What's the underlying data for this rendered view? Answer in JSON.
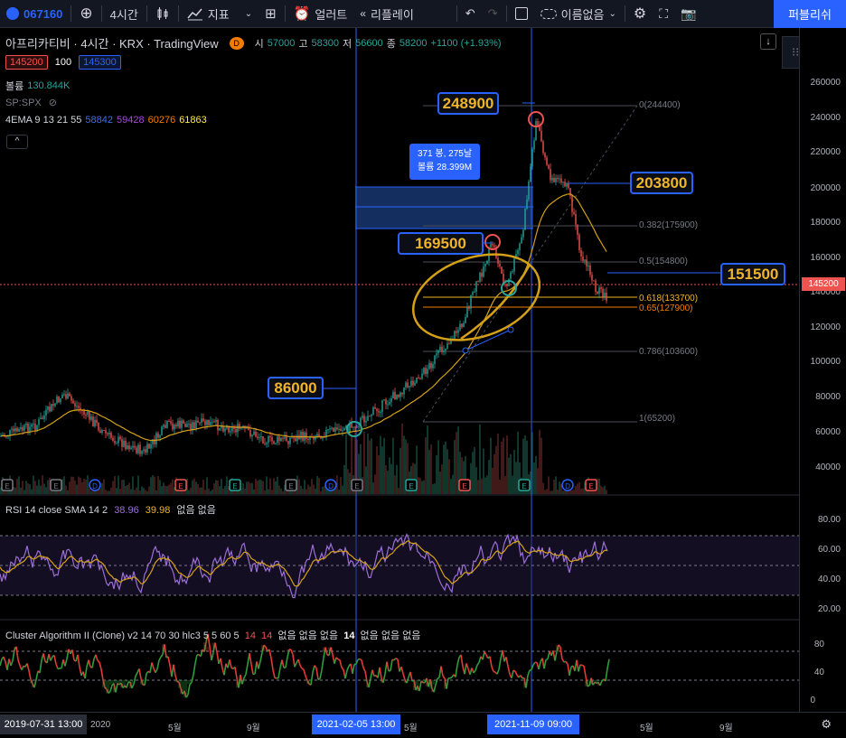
{
  "toolbar": {
    "symbol": "067160",
    "interval": "4시간",
    "indicators": "지표",
    "alert": "얼러트",
    "replay": "리플레이",
    "layout_name": "이름없음",
    "publish": "퍼블리쉬"
  },
  "header": {
    "title": "아프리카티비 · 4시간 · KRX · TradingView",
    "badge": "D",
    "o_label": "시",
    "o_val": "57000",
    "h_label": "고",
    "h_val": "58300",
    "l_label": "저",
    "l_val": "56600",
    "c_label": "종",
    "c_val": "58200",
    "change": "+1100 (+1.93%)",
    "bid": "145200",
    "spread": "100",
    "ask": "145300"
  },
  "legends": {
    "volume_label": "볼륨",
    "volume_val": "130.844K",
    "compare": "SP:SPX",
    "ema_label": "4EMA 9 13 21 55",
    "ema_vals": [
      "58842",
      "59428",
      "60276",
      "61863"
    ],
    "ema_colors": [
      "#3f6cf0",
      "#a04ad8",
      "#f57c00",
      "#ffeb3b"
    ]
  },
  "rsi": {
    "label": "RSI 14 close SMA 14 2",
    "val1": "38.96",
    "val2": "39.98",
    "extra": "없음 없음",
    "ticks": [
      "80.00",
      "60.00",
      "40.00",
      "20.00"
    ]
  },
  "cluster": {
    "label": "Cluster Algorithm II (Clone) v2 14 70 30 hlc3 5 5 60 5",
    "v1": "14",
    "v2": "14",
    "mid1": "없음 없음 없음",
    "v3": "14",
    "mid2": "없음 없음 없음",
    "ticks": [
      "80",
      "40",
      "0"
    ]
  },
  "price_ticks": [
    "260000",
    "240000",
    "220000",
    "200000",
    "180000",
    "160000",
    "140000",
    "120000",
    "100000",
    "80000",
    "60000",
    "40000"
  ],
  "current_price": "145200",
  "callouts": [
    "248900",
    "203800",
    "169500",
    "151500",
    "86000"
  ],
  "fib": [
    "0(244400)",
    "0.382(175900)",
    "0.5(154800)",
    "0.618(133700)",
    "0.65(127900)",
    "0.786(103600)",
    "1(65200)"
  ],
  "range_box": {
    "line1": "371 봉, 275날",
    "line2": "볼륨 28.399M"
  },
  "time_ticks": {
    "t2020": "2020",
    "may1": "5월",
    "sep1": "9월",
    "may2": "5월",
    "may3": "5월",
    "sep3": "9월"
  },
  "time_badges": {
    "left": "2019-07-31   13:00",
    "mid": "2021-02-05   13:00",
    "right": "2021-11-09   09:00"
  },
  "colors": {
    "accent": "#2962ff",
    "up": "#26a69a",
    "down": "#ef5350",
    "callout_text": "#f0b429"
  }
}
